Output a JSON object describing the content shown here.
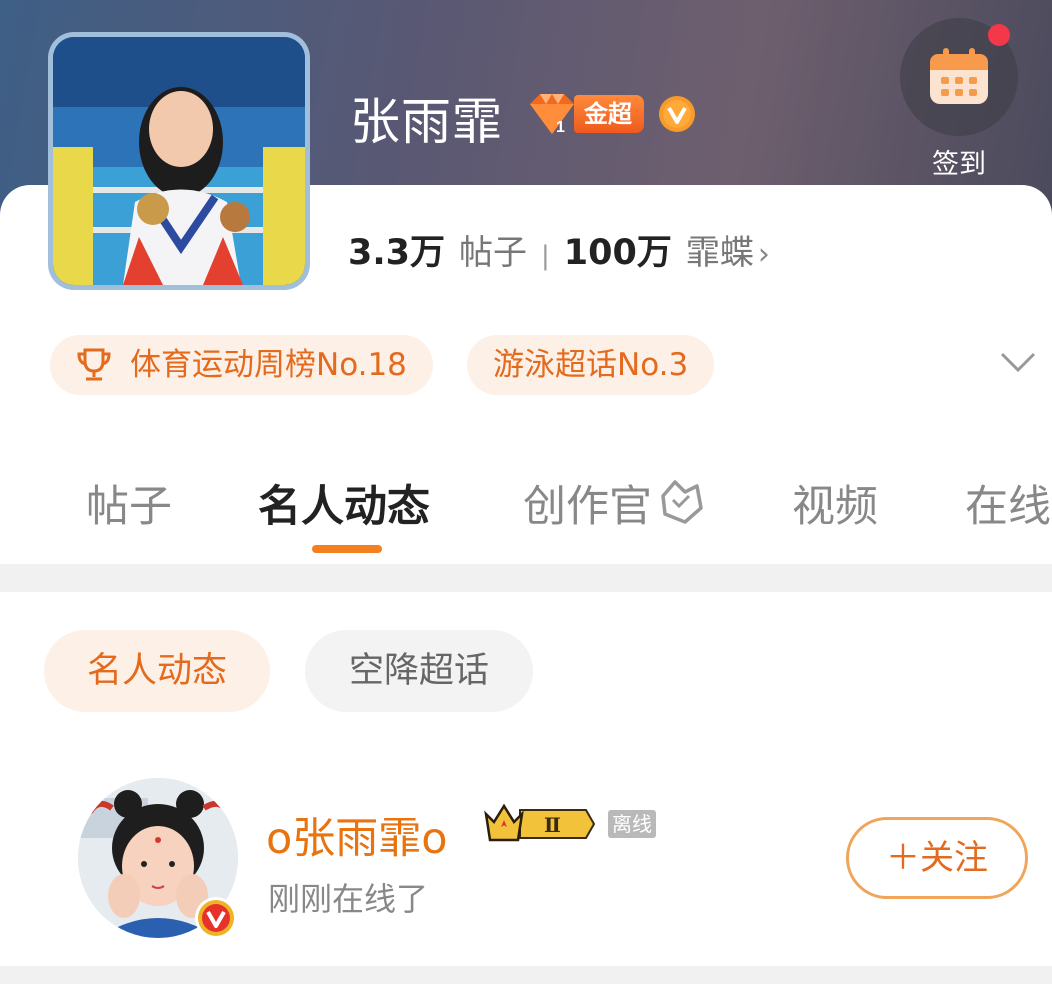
{
  "header": {
    "title": "张雨霏",
    "gem_badge_icon": "diamond-level-1-icon",
    "super_badge_label": "金超",
    "verified_icon": "verified-v-icon",
    "checkin": {
      "icon": "calendar-icon",
      "label": "签到",
      "has_notification": true
    }
  },
  "stats": {
    "posts_count": "3.3万",
    "posts_label": "帖子",
    "separator": "|",
    "fans_count": "100万",
    "fans_label": "霏蝶",
    "fans_chevron": "›"
  },
  "rankings": [
    {
      "icon": "trophy-icon",
      "label": "体育运动周榜No.18"
    },
    {
      "label": "游泳超话No.3"
    }
  ],
  "expand_icon": "chevron-down-icon",
  "tabs": [
    {
      "label": "帖子",
      "active": false
    },
    {
      "label": "名人动态",
      "active": true
    },
    {
      "label": "创作官",
      "active": false,
      "icon": "creator-badge-icon"
    },
    {
      "label": "视频",
      "active": false
    },
    {
      "label": "在线",
      "active": false
    }
  ],
  "sub_tabs": [
    {
      "label": "名人动态",
      "active": true
    },
    {
      "label": "空降超话",
      "active": false
    }
  ],
  "user": {
    "name": "o张雨霏o",
    "level_badge": "Ⅱ",
    "level_icon": "crown-icon",
    "online_tag": "离线",
    "status": "刚刚在线了",
    "verified_icon": "verified-v-icon",
    "follow_label": "＋关注"
  },
  "colors": {
    "accent": "#f47f20",
    "accent_text": "#e46a1d",
    "pill_bg": "#fdf0e6",
    "banner": "#5a5873",
    "notification": "#f5374a"
  }
}
